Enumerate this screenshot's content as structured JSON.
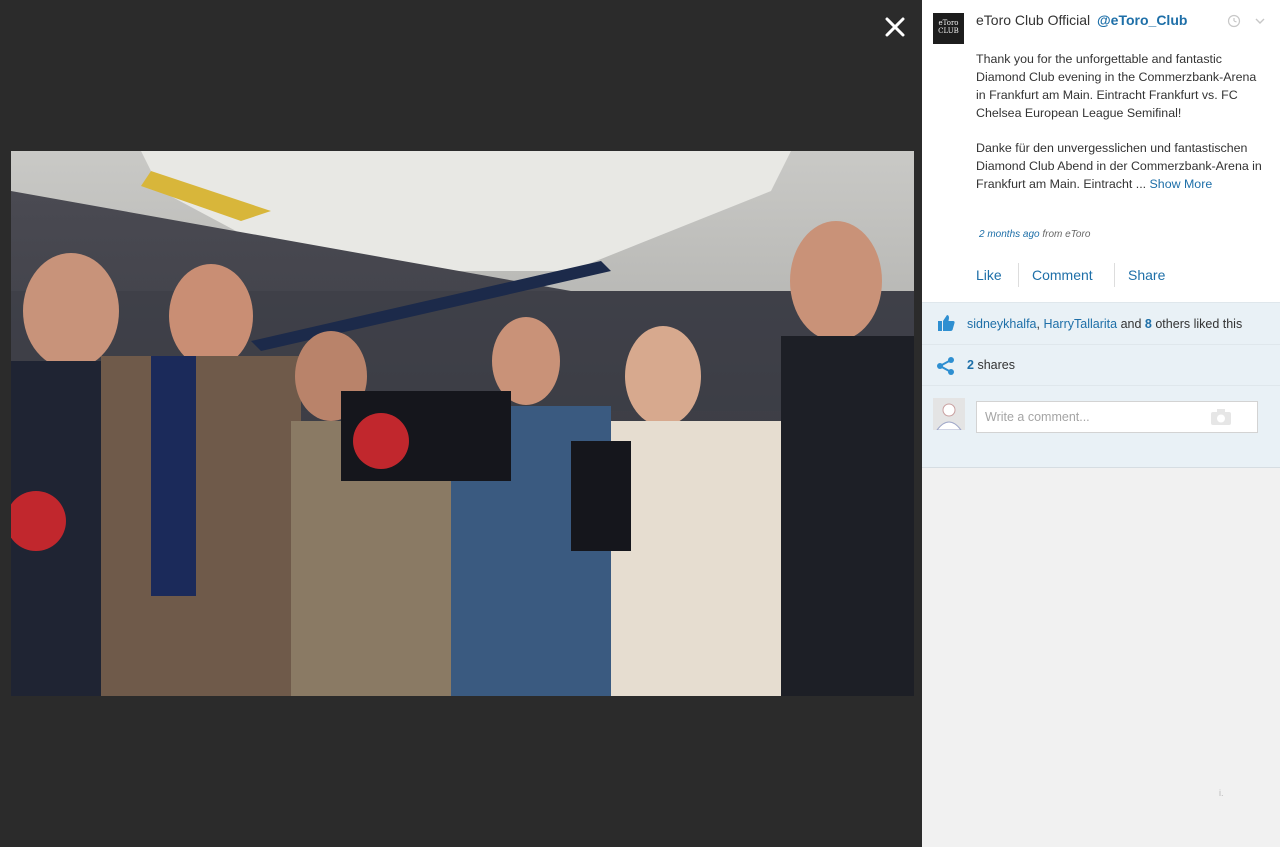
{
  "viewer": {
    "close_icon": "close-icon",
    "photo_description_icon": "stadium-photo"
  },
  "post": {
    "author_name": "eToro Club Official",
    "author_handle": "@eToro_Club",
    "avatar_text_line1": "eToro",
    "avatar_text_line2": "CLUB",
    "paragraph_en": "Thank you for the unforgettable and fantastic Diamond Club evening in the Commerzbank-Arena in Frankfurt am Main. Eintracht Frankfurt vs. FC Chelsea European League Semifinal!",
    "paragraph_de": "Danke für den unvergesslichen und fantastischen Diamond Club Abend in der Commerzbank-Arena in Frankfurt am Main. Eintracht ...",
    "show_more": "Show More",
    "time_ago": "2 months ago",
    "source": "from eToro",
    "actions": {
      "like": "Like",
      "comment": "Comment",
      "share": "Share"
    }
  },
  "likes": {
    "user1": "sidneykhalfa",
    "user2": "HarryTallarita",
    "and": "and",
    "others_count": "8",
    "others_text": "others liked this"
  },
  "shares": {
    "count": "2",
    "label": "shares"
  },
  "comment": {
    "placeholder": "Write a comment..."
  },
  "colors": {
    "link": "#1e6fa8",
    "panel": "#e9f1f6",
    "viewer_bg": "#2b2b2b"
  },
  "footer_mark": "i."
}
